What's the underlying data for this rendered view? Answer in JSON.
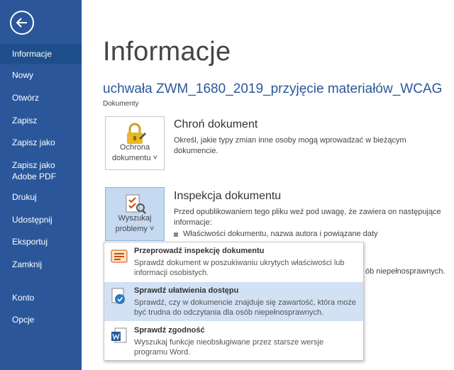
{
  "sidebar": {
    "items": [
      {
        "label": "Informacje",
        "active": true
      },
      {
        "label": "Nowy"
      },
      {
        "label": "Otwórz"
      },
      {
        "label": "Zapisz"
      },
      {
        "label": "Zapisz jako"
      },
      {
        "label": "Zapisz jako\nAdobe PDF"
      },
      {
        "label": "Drukuj"
      },
      {
        "label": "Udostępnij"
      },
      {
        "label": "Eksportuj"
      },
      {
        "label": "Zamknij"
      },
      {
        "label": "Konto"
      },
      {
        "label": "Opcje"
      }
    ]
  },
  "main": {
    "page_title": "Informacje",
    "doc_title": "uchwała ZWM_1680_2019_przyjęcie materiałów_WCAG",
    "doc_location": "Dokumenty",
    "protect": {
      "button_label": "Ochrona\ndokumentu ˅",
      "title": "Chroń dokument",
      "desc": "Określ, jakie typy zmian inne osoby mogą wprowadzać w bieżącym dokumencie."
    },
    "inspect": {
      "button_label": "Wyszukaj\nproblemy ˅",
      "title": "Inspekcja dokumentu",
      "desc": "Przed opublikowaniem tego pliku weź pod uwagę, że zawiera on następujące informacje:",
      "bullet": "Właściwości dokumentu, nazwa autora i powiązane daty",
      "partial_text": "ób niepełnosprawnych."
    }
  },
  "menu": {
    "items": [
      {
        "title": "Przeprowadź inspekcję dokumentu",
        "desc": "Sprawdź dokument w poszukiwaniu ukrytych właściwości lub informacji osobistych."
      },
      {
        "title": "Sprawdź ułatwienia dostępu",
        "desc": "Sprawdź, czy w dokumencie znajduje się zawartość, która może być trudna do odczytania dla osób niepełnosprawnych."
      },
      {
        "title": "Sprawdź zgodność",
        "desc": "Wyszukaj funkcje nieobsługiwane przez starsze wersje programu Word."
      }
    ]
  },
  "colors": {
    "sidebar": "#2b579a",
    "accent": "#2b579a",
    "menu_hover": "#d3e1f4"
  }
}
